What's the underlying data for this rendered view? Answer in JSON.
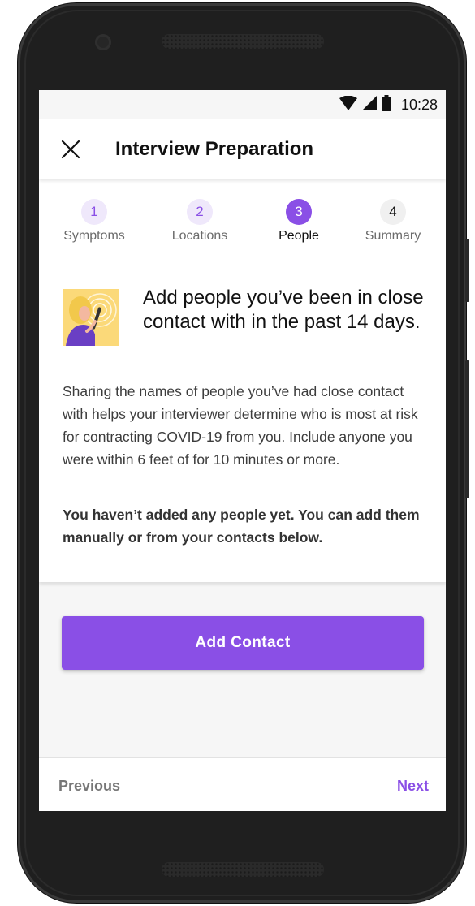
{
  "status_bar": {
    "time": "10:28",
    "icons": [
      "wifi-icon",
      "cell-signal-icon",
      "battery-icon"
    ]
  },
  "app_bar": {
    "close_icon": "close-icon",
    "title": "Interview Preparation"
  },
  "stepper": {
    "steps": [
      {
        "number": "1",
        "label": "Symptoms",
        "state": "completed"
      },
      {
        "number": "2",
        "label": "Locations",
        "state": "completed"
      },
      {
        "number": "3",
        "label": "People",
        "state": "active"
      },
      {
        "number": "4",
        "label": "Summary",
        "state": "upcoming"
      }
    ]
  },
  "content": {
    "illustration": "person-on-phone-icon",
    "headline": "Add people you’ve been in close contact with in the past 14 days.",
    "body": "Sharing the names of people you’ve had close contact with helps your interviewer determine who is most at risk for contracting COVID-19 from you. Include anyone you were within 6 feet of for 10 minutes or more.",
    "notice": "You haven’t added any people yet. You can add them manually or from your contacts below."
  },
  "actions": {
    "add_contact_label": "Add Contact"
  },
  "bottom_nav": {
    "previous_label": "Previous",
    "next_label": "Next"
  },
  "colors": {
    "accent": "#8a4fe6",
    "accent_light": "#efe8fb",
    "illustration_bg": "#fbd979"
  }
}
